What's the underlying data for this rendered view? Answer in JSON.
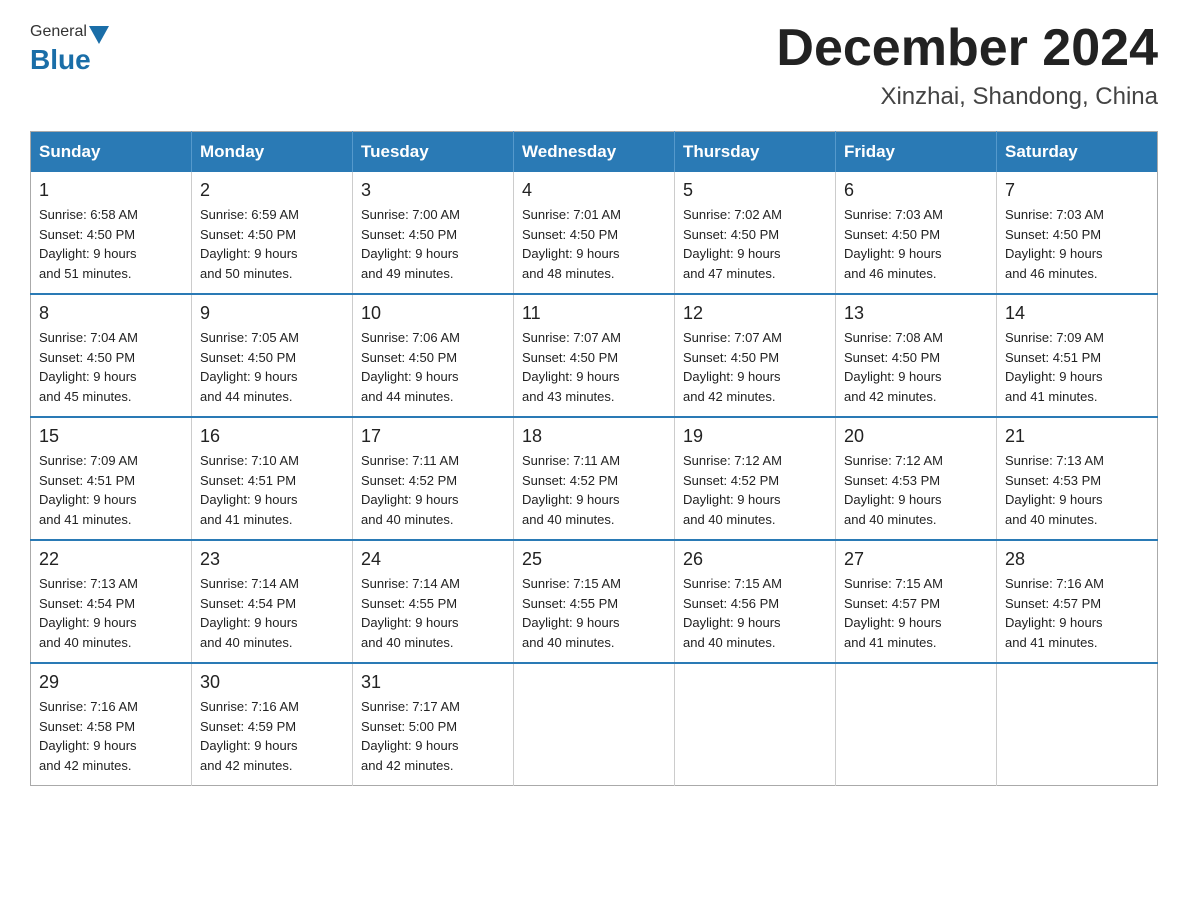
{
  "header": {
    "logo": {
      "part1": "General",
      "part2": "Blue"
    },
    "title": "December 2024",
    "subtitle": "Xinzhai, Shandong, China"
  },
  "weekdays": [
    "Sunday",
    "Monday",
    "Tuesday",
    "Wednesday",
    "Thursday",
    "Friday",
    "Saturday"
  ],
  "weeks": [
    [
      {
        "day": 1,
        "sunrise": "6:58 AM",
        "sunset": "4:50 PM",
        "daylight": "9 hours and 51 minutes."
      },
      {
        "day": 2,
        "sunrise": "6:59 AM",
        "sunset": "4:50 PM",
        "daylight": "9 hours and 50 minutes."
      },
      {
        "day": 3,
        "sunrise": "7:00 AM",
        "sunset": "4:50 PM",
        "daylight": "9 hours and 49 minutes."
      },
      {
        "day": 4,
        "sunrise": "7:01 AM",
        "sunset": "4:50 PM",
        "daylight": "9 hours and 48 minutes."
      },
      {
        "day": 5,
        "sunrise": "7:02 AM",
        "sunset": "4:50 PM",
        "daylight": "9 hours and 47 minutes."
      },
      {
        "day": 6,
        "sunrise": "7:03 AM",
        "sunset": "4:50 PM",
        "daylight": "9 hours and 46 minutes."
      },
      {
        "day": 7,
        "sunrise": "7:03 AM",
        "sunset": "4:50 PM",
        "daylight": "9 hours and 46 minutes."
      }
    ],
    [
      {
        "day": 8,
        "sunrise": "7:04 AM",
        "sunset": "4:50 PM",
        "daylight": "9 hours and 45 minutes."
      },
      {
        "day": 9,
        "sunrise": "7:05 AM",
        "sunset": "4:50 PM",
        "daylight": "9 hours and 44 minutes."
      },
      {
        "day": 10,
        "sunrise": "7:06 AM",
        "sunset": "4:50 PM",
        "daylight": "9 hours and 44 minutes."
      },
      {
        "day": 11,
        "sunrise": "7:07 AM",
        "sunset": "4:50 PM",
        "daylight": "9 hours and 43 minutes."
      },
      {
        "day": 12,
        "sunrise": "7:07 AM",
        "sunset": "4:50 PM",
        "daylight": "9 hours and 42 minutes."
      },
      {
        "day": 13,
        "sunrise": "7:08 AM",
        "sunset": "4:50 PM",
        "daylight": "9 hours and 42 minutes."
      },
      {
        "day": 14,
        "sunrise": "7:09 AM",
        "sunset": "4:51 PM",
        "daylight": "9 hours and 41 minutes."
      }
    ],
    [
      {
        "day": 15,
        "sunrise": "7:09 AM",
        "sunset": "4:51 PM",
        "daylight": "9 hours and 41 minutes."
      },
      {
        "day": 16,
        "sunrise": "7:10 AM",
        "sunset": "4:51 PM",
        "daylight": "9 hours and 41 minutes."
      },
      {
        "day": 17,
        "sunrise": "7:11 AM",
        "sunset": "4:52 PM",
        "daylight": "9 hours and 40 minutes."
      },
      {
        "day": 18,
        "sunrise": "7:11 AM",
        "sunset": "4:52 PM",
        "daylight": "9 hours and 40 minutes."
      },
      {
        "day": 19,
        "sunrise": "7:12 AM",
        "sunset": "4:52 PM",
        "daylight": "9 hours and 40 minutes."
      },
      {
        "day": 20,
        "sunrise": "7:12 AM",
        "sunset": "4:53 PM",
        "daylight": "9 hours and 40 minutes."
      },
      {
        "day": 21,
        "sunrise": "7:13 AM",
        "sunset": "4:53 PM",
        "daylight": "9 hours and 40 minutes."
      }
    ],
    [
      {
        "day": 22,
        "sunrise": "7:13 AM",
        "sunset": "4:54 PM",
        "daylight": "9 hours and 40 minutes."
      },
      {
        "day": 23,
        "sunrise": "7:14 AM",
        "sunset": "4:54 PM",
        "daylight": "9 hours and 40 minutes."
      },
      {
        "day": 24,
        "sunrise": "7:14 AM",
        "sunset": "4:55 PM",
        "daylight": "9 hours and 40 minutes."
      },
      {
        "day": 25,
        "sunrise": "7:15 AM",
        "sunset": "4:55 PM",
        "daylight": "9 hours and 40 minutes."
      },
      {
        "day": 26,
        "sunrise": "7:15 AM",
        "sunset": "4:56 PM",
        "daylight": "9 hours and 40 minutes."
      },
      {
        "day": 27,
        "sunrise": "7:15 AM",
        "sunset": "4:57 PM",
        "daylight": "9 hours and 41 minutes."
      },
      {
        "day": 28,
        "sunrise": "7:16 AM",
        "sunset": "4:57 PM",
        "daylight": "9 hours and 41 minutes."
      }
    ],
    [
      {
        "day": 29,
        "sunrise": "7:16 AM",
        "sunset": "4:58 PM",
        "daylight": "9 hours and 42 minutes."
      },
      {
        "day": 30,
        "sunrise": "7:16 AM",
        "sunset": "4:59 PM",
        "daylight": "9 hours and 42 minutes."
      },
      {
        "day": 31,
        "sunrise": "7:17 AM",
        "sunset": "5:00 PM",
        "daylight": "9 hours and 42 minutes."
      },
      null,
      null,
      null,
      null
    ]
  ],
  "labels": {
    "sunrise": "Sunrise:",
    "sunset": "Sunset:",
    "daylight": "Daylight:"
  }
}
